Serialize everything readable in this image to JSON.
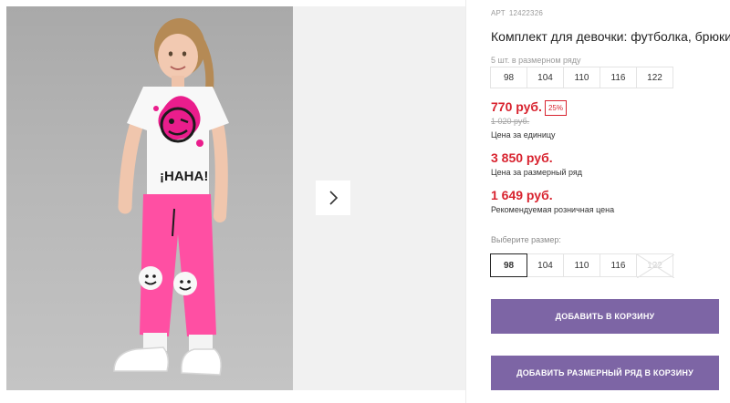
{
  "product": {
    "art_label": "АРТ",
    "art_number": "12422326",
    "title": "Комплект для девочки: футболка, брюки"
  },
  "size_row": {
    "caption": "5 шт. в размерном ряду",
    "sizes": [
      "98",
      "104",
      "110",
      "116",
      "122"
    ]
  },
  "pricing": {
    "unit_price": "770 руб.",
    "discount": "25%",
    "old_price": "1 020 руб.",
    "unit_label": "Цена за единицу",
    "row_price": "3 850 руб.",
    "row_label": "Цена за размерный ряд",
    "retail_price": "1 649 руб.",
    "retail_label": "Рекомендуемая розничная цена"
  },
  "size_picker": {
    "label": "Выберите размер:",
    "options": [
      {
        "label": "98",
        "state": "selected"
      },
      {
        "label": "104",
        "state": "available"
      },
      {
        "label": "110",
        "state": "available"
      },
      {
        "label": "116",
        "state": "available"
      },
      {
        "label": "122",
        "state": "disabled"
      }
    ]
  },
  "actions": {
    "add_to_cart": "ДОБАВИТЬ В КОРЗИНУ",
    "add_row_to_cart": "ДОБАВИТЬ РАЗМЕРНЫЙ РЯД В КОРЗИНУ"
  },
  "gallery": {
    "next_icon": "chevron-right-icon"
  },
  "colors": {
    "price_red": "#d8232f",
    "button_purple": "#7d65a5",
    "shirt_print_pink": "#ea1d8c",
    "pants_pink": "#ff4fa3"
  }
}
